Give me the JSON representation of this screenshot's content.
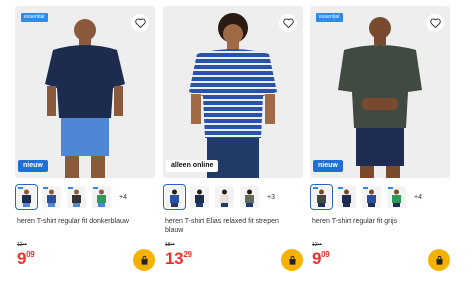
{
  "accent": "#2f8be6",
  "price_color": "#e8332b",
  "cart_color": "#f5b300",
  "products": [
    {
      "top_badge": "essential",
      "bottom_badge": "nieuw",
      "swatch_more": "+4",
      "name": "heren T-shirt regular fit donkerblauw",
      "old_price": "12⁹⁵",
      "price_int": "9",
      "price_cents": "09",
      "shirt_color": "#1d2b4f",
      "shorts_color": "#4f86d6"
    },
    {
      "top_badge": "",
      "bottom_badge": "alleen online",
      "swatch_more": "+3",
      "name": "heren T-shirt Elias relaxed fit strepen blauw",
      "old_price": "18⁹⁵",
      "price_int": "13",
      "price_cents": "29",
      "shirt_color": "#2a52a6",
      "shorts_color": "#223a66"
    },
    {
      "top_badge": "essential",
      "bottom_badge": "nieuw",
      "swatch_more": "+4",
      "name": "heren T-shirt regular fit grijs",
      "old_price": "12⁹⁵",
      "price_int": "9",
      "price_cents": "09",
      "shirt_color": "#404a40",
      "shorts_color": "#1f2d52"
    }
  ],
  "icons": {
    "favorite": "heart-icon",
    "cart": "shopping-bag-icon"
  }
}
